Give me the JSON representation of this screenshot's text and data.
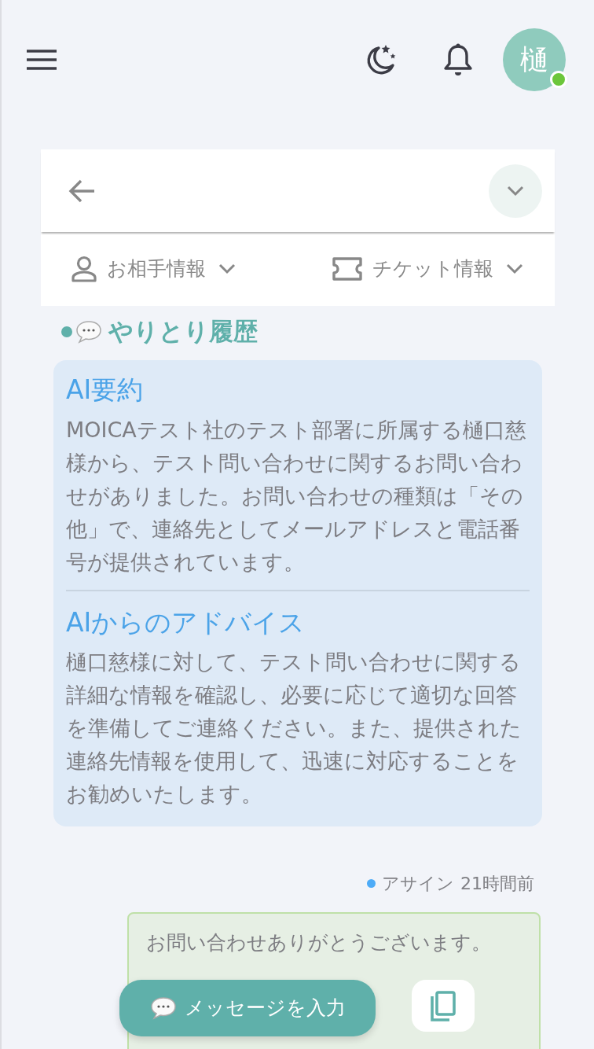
{
  "header": {
    "avatar": {
      "initial": "樋",
      "online": true
    }
  },
  "panel": {
    "sections": [
      {
        "label": "お相手情報",
        "kind": "person",
        "expanded": false
      },
      {
        "label": "チケット情報",
        "kind": "ticket",
        "expanded": false
      }
    ]
  },
  "history": {
    "title": "やりとり履歴",
    "ai_blocks": [
      {
        "title": "AI要約",
        "body": "MOICAテスト社のテスト部署に所属する樋口慈様から、テスト問い合わせに関するお問い合わせがありました。お問い合わせの種類は「その他」で、連絡先としてメールアドレスと電話番号が提供されています。"
      },
      {
        "title": "AIからのアドバイス",
        "body": "樋口慈様に対して、テスト問い合わせに関する詳細な情報を確認し、必要に応じて適切な回答を準備してご連絡ください。また、提供された連絡先情報を使用して、迅速に対応することをお勧めいたします。"
      }
    ],
    "events": [
      {
        "label": "アサイン",
        "time": "21時間前",
        "color": "#4dabf7",
        "message": "お問い合わせありがとうございます。"
      }
    ]
  },
  "composer": {
    "label": "メッセージを入力"
  }
}
